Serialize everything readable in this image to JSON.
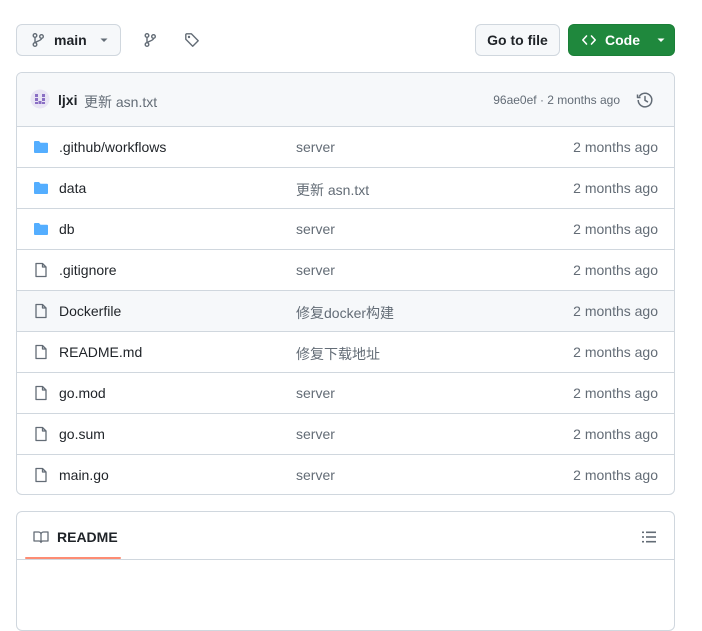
{
  "toolbar": {
    "branch_label": "main",
    "goto_file_label": "Go to file",
    "code_label": "Code"
  },
  "commit": {
    "author": "ljxi",
    "message": "更新 asn.txt",
    "meta": "96ae0ef · 2 months ago"
  },
  "files": [
    {
      "type": "dir",
      "name": ".github/workflows",
      "message": "server",
      "age": "2 months ago"
    },
    {
      "type": "dir",
      "name": "data",
      "message": "更新 asn.txt",
      "age": "2 months ago"
    },
    {
      "type": "dir",
      "name": "db",
      "message": "server",
      "age": "2 months ago"
    },
    {
      "type": "file",
      "name": ".gitignore",
      "message": "server",
      "age": "2 months ago"
    },
    {
      "type": "file",
      "name": "Dockerfile",
      "message": "修复docker构建",
      "age": "2 months ago"
    },
    {
      "type": "file",
      "name": "README.md",
      "message": "修复下载地址",
      "age": "2 months ago"
    },
    {
      "type": "file",
      "name": "go.mod",
      "message": "server",
      "age": "2 months ago"
    },
    {
      "type": "file",
      "name": "go.sum",
      "message": "server",
      "age": "2 months ago"
    },
    {
      "type": "file",
      "name": "main.go",
      "message": "server",
      "age": "2 months ago"
    }
  ],
  "readme": {
    "tab_label": "README"
  },
  "colors": {
    "accent_green": "#1f883d",
    "folder_blue": "#54aeff",
    "readme_underline": "#fd8c73"
  }
}
